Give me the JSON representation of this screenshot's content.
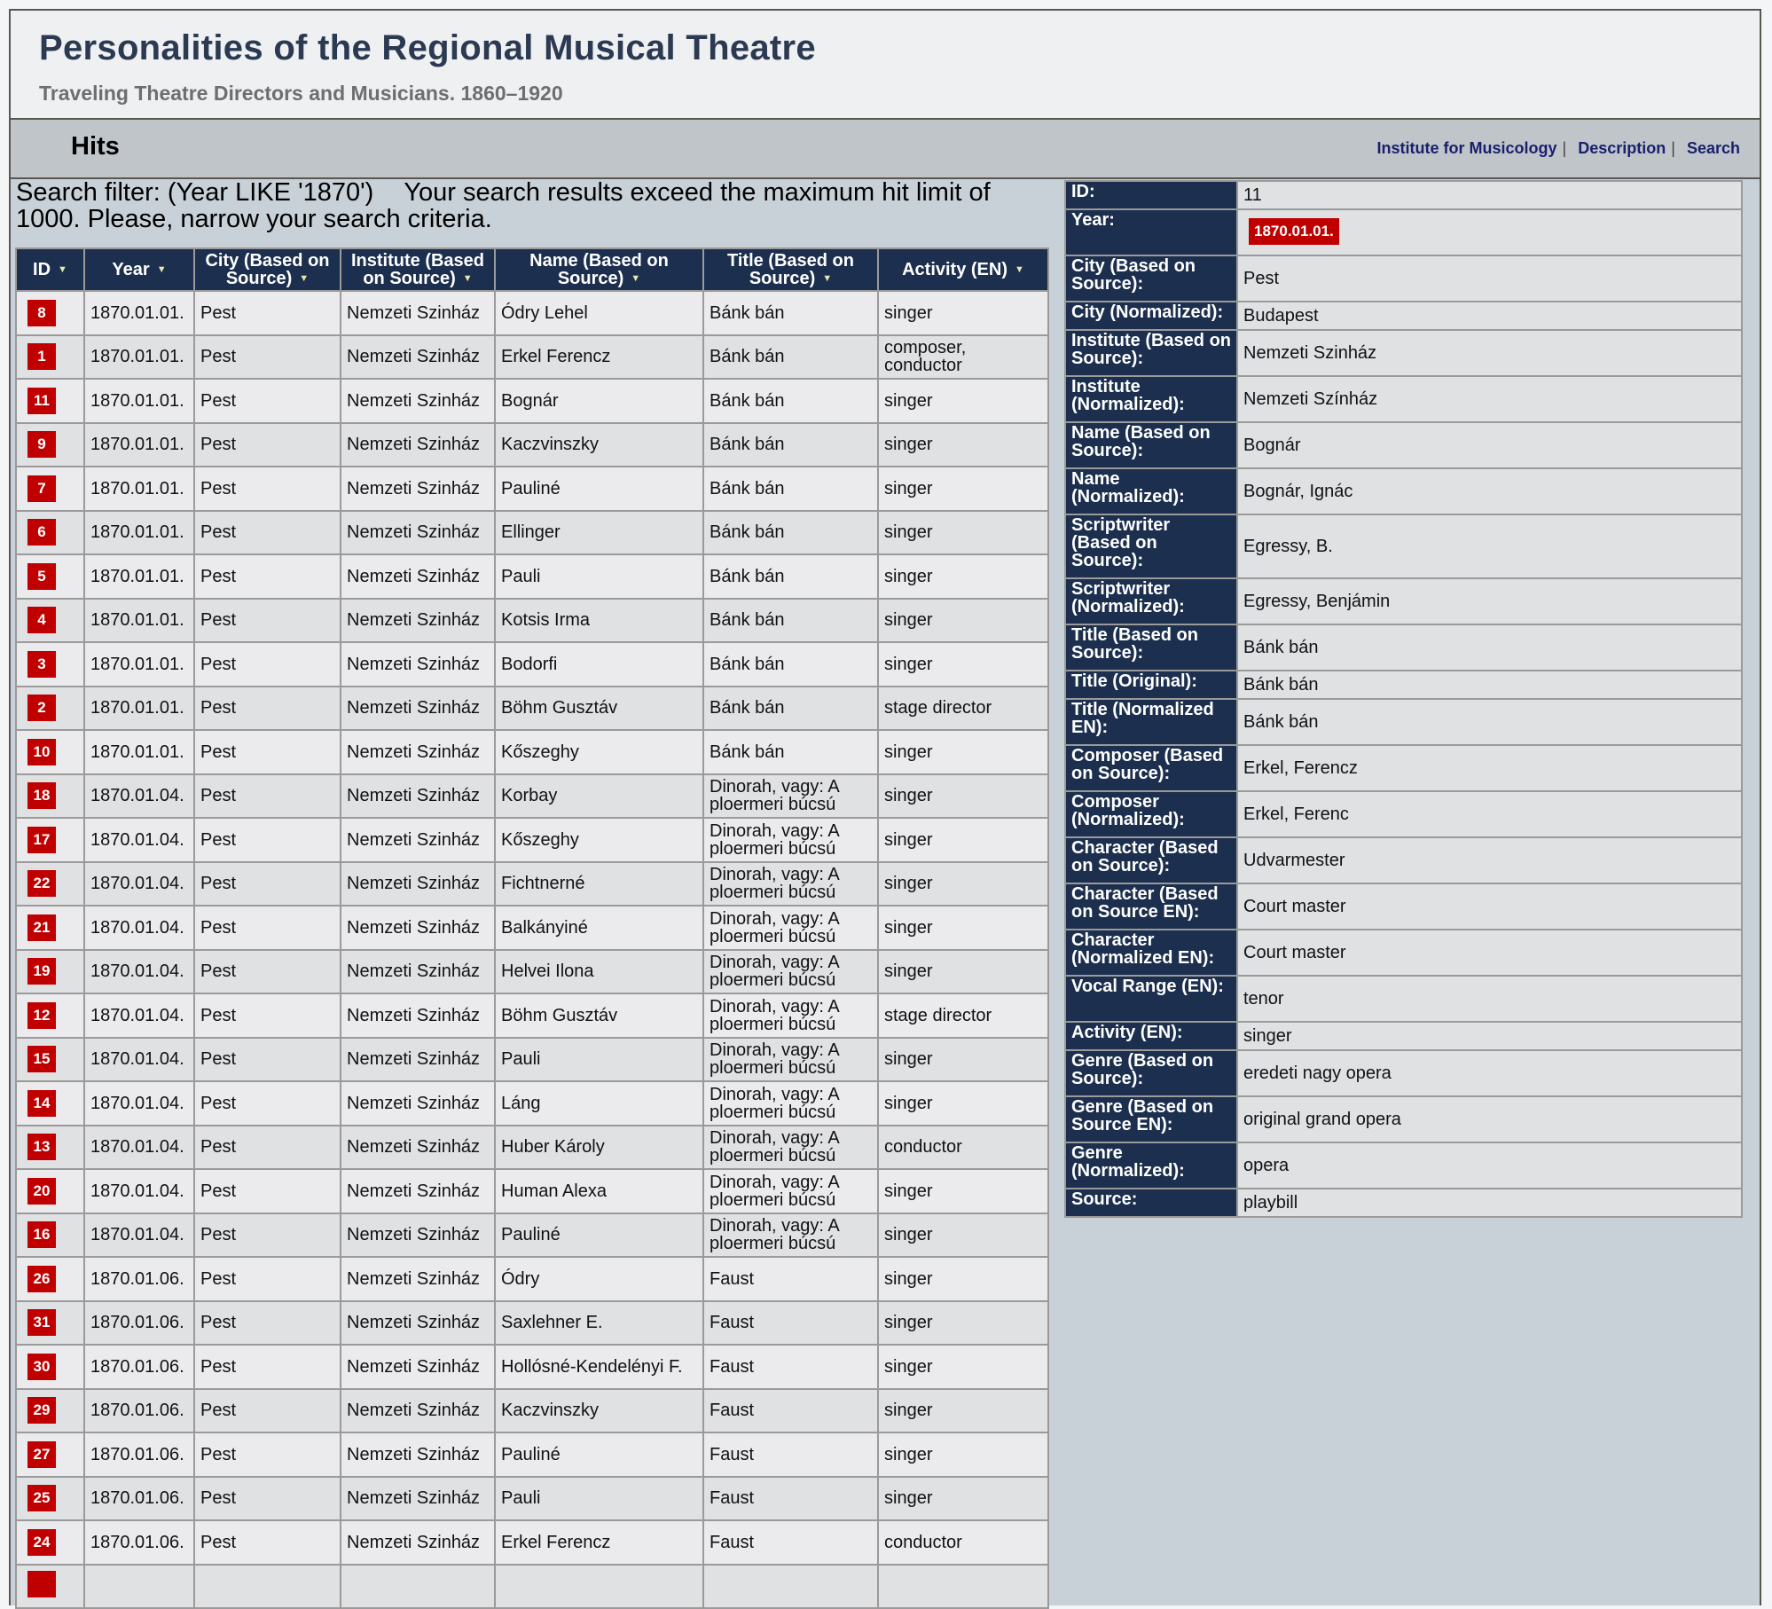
{
  "header": {
    "title": "Personalities of the Regional Musical Theatre",
    "subtitle": "Traveling Theatre Directors and Musicians. 1860–1920"
  },
  "nav": {
    "page_title": "Hits",
    "links": [
      {
        "label": "Institute for Musicology"
      },
      {
        "label": "Description"
      },
      {
        "label": "Search"
      }
    ],
    "separator": "|"
  },
  "search": {
    "filter_text": "Search filter: (Year LIKE '1870')",
    "warning_text": "Your search results exceed the maximum hit limit of 1000. Please, narrow your search criteria."
  },
  "colors": {
    "header_navy": "#1c2f4e",
    "badge_red": "#c00000",
    "link_navy": "#1a1f6e"
  },
  "table": {
    "sort_icon": "▼",
    "columns": [
      {
        "label": "ID"
      },
      {
        "label": "Year"
      },
      {
        "label": "City (Based on Source)"
      },
      {
        "label": "Institute (Based on Source)"
      },
      {
        "label": "Name (Based on Source)"
      },
      {
        "label": "Title (Based on Source)"
      },
      {
        "label": "Activity (EN)"
      }
    ],
    "rows": [
      {
        "id": "8",
        "year": "1870.01.01.",
        "city": "Pest",
        "institute": "Nemzeti Szinház",
        "name": "Ódry Lehel",
        "title": "Bánk bán",
        "activity": "singer"
      },
      {
        "id": "1",
        "year": "1870.01.01.",
        "city": "Pest",
        "institute": "Nemzeti Szinház",
        "name": "Erkel Ferencz",
        "title": "Bánk bán",
        "activity": "composer, conductor"
      },
      {
        "id": "11",
        "year": "1870.01.01.",
        "city": "Pest",
        "institute": "Nemzeti Szinház",
        "name": "Bognár",
        "title": "Bánk bán",
        "activity": "singer"
      },
      {
        "id": "9",
        "year": "1870.01.01.",
        "city": "Pest",
        "institute": "Nemzeti Szinház",
        "name": "Kaczvinszky",
        "title": "Bánk bán",
        "activity": "singer"
      },
      {
        "id": "7",
        "year": "1870.01.01.",
        "city": "Pest",
        "institute": "Nemzeti Szinház",
        "name": "Pauliné",
        "title": "Bánk bán",
        "activity": "singer"
      },
      {
        "id": "6",
        "year": "1870.01.01.",
        "city": "Pest",
        "institute": "Nemzeti Szinház",
        "name": "Ellinger",
        "title": "Bánk bán",
        "activity": "singer"
      },
      {
        "id": "5",
        "year": "1870.01.01.",
        "city": "Pest",
        "institute": "Nemzeti Szinház",
        "name": "Pauli",
        "title": "Bánk bán",
        "activity": "singer"
      },
      {
        "id": "4",
        "year": "1870.01.01.",
        "city": "Pest",
        "institute": "Nemzeti Szinház",
        "name": "Kotsis Irma",
        "title": "Bánk bán",
        "activity": "singer"
      },
      {
        "id": "3",
        "year": "1870.01.01.",
        "city": "Pest",
        "institute": "Nemzeti Szinház",
        "name": "Bodorfi",
        "title": "Bánk bán",
        "activity": "singer"
      },
      {
        "id": "2",
        "year": "1870.01.01.",
        "city": "Pest",
        "institute": "Nemzeti Szinház",
        "name": "Böhm Gusztáv",
        "title": "Bánk bán",
        "activity": "stage director"
      },
      {
        "id": "10",
        "year": "1870.01.01.",
        "city": "Pest",
        "institute": "Nemzeti Szinház",
        "name": "Kőszeghy",
        "title": "Bánk bán",
        "activity": "singer"
      },
      {
        "id": "18",
        "year": "1870.01.04.",
        "city": "Pest",
        "institute": "Nemzeti Szinház",
        "name": "Korbay",
        "title": "Dinorah, vagy: A ploermeri búcsú",
        "activity": "singer"
      },
      {
        "id": "17",
        "year": "1870.01.04.",
        "city": "Pest",
        "institute": "Nemzeti Szinház",
        "name": "Kőszeghy",
        "title": "Dinorah, vagy: A ploermeri búcsú",
        "activity": "singer"
      },
      {
        "id": "22",
        "year": "1870.01.04.",
        "city": "Pest",
        "institute": "Nemzeti Szinház",
        "name": "Fichtnerné",
        "title": "Dinorah, vagy: A ploermeri búcsú",
        "activity": "singer"
      },
      {
        "id": "21",
        "year": "1870.01.04.",
        "city": "Pest",
        "institute": "Nemzeti Szinház",
        "name": "Balkányiné",
        "title": "Dinorah, vagy: A ploermeri búcsú",
        "activity": "singer"
      },
      {
        "id": "19",
        "year": "1870.01.04.",
        "city": "Pest",
        "institute": "Nemzeti Szinház",
        "name": "Helvei Ilona",
        "title": "Dinorah, vagy: A ploermeri búcsú",
        "activity": "singer"
      },
      {
        "id": "12",
        "year": "1870.01.04.",
        "city": "Pest",
        "institute": "Nemzeti Szinház",
        "name": "Böhm Gusztáv",
        "title": "Dinorah, vagy: A ploermeri búcsú",
        "activity": "stage director"
      },
      {
        "id": "15",
        "year": "1870.01.04.",
        "city": "Pest",
        "institute": "Nemzeti Szinház",
        "name": "Pauli",
        "title": "Dinorah, vagy: A ploermeri búcsú",
        "activity": "singer"
      },
      {
        "id": "14",
        "year": "1870.01.04.",
        "city": "Pest",
        "institute": "Nemzeti Szinház",
        "name": "Láng",
        "title": "Dinorah, vagy: A ploermeri búcsú",
        "activity": "singer"
      },
      {
        "id": "13",
        "year": "1870.01.04.",
        "city": "Pest",
        "institute": "Nemzeti Szinház",
        "name": "Huber Károly",
        "title": "Dinorah, vagy: A ploermeri búcsú",
        "activity": "conductor"
      },
      {
        "id": "20",
        "year": "1870.01.04.",
        "city": "Pest",
        "institute": "Nemzeti Szinház",
        "name": "Human Alexa",
        "title": "Dinorah, vagy: A ploermeri búcsú",
        "activity": "singer"
      },
      {
        "id": "16",
        "year": "1870.01.04.",
        "city": "Pest",
        "institute": "Nemzeti Szinház",
        "name": "Pauliné",
        "title": "Dinorah, vagy: A ploermeri búcsú",
        "activity": "singer"
      },
      {
        "id": "26",
        "year": "1870.01.06.",
        "city": "Pest",
        "institute": "Nemzeti Szinház",
        "name": "Ódry",
        "title": "Faust",
        "activity": "singer"
      },
      {
        "id": "31",
        "year": "1870.01.06.",
        "city": "Pest",
        "institute": "Nemzeti Szinház",
        "name": "Saxlehner E.",
        "title": "Faust",
        "activity": "singer"
      },
      {
        "id": "30",
        "year": "1870.01.06.",
        "city": "Pest",
        "institute": "Nemzeti Szinház",
        "name": "Hollósné-Kendelényi F.",
        "title": "Faust",
        "activity": "singer"
      },
      {
        "id": "29",
        "year": "1870.01.06.",
        "city": "Pest",
        "institute": "Nemzeti Szinház",
        "name": "Kaczvinszky",
        "title": "Faust",
        "activity": "singer"
      },
      {
        "id": "27",
        "year": "1870.01.06.",
        "city": "Pest",
        "institute": "Nemzeti Szinház",
        "name": "Pauliné",
        "title": "Faust",
        "activity": "singer"
      },
      {
        "id": "25",
        "year": "1870.01.06.",
        "city": "Pest",
        "institute": "Nemzeti Szinház",
        "name": "Pauli",
        "title": "Faust",
        "activity": "singer"
      },
      {
        "id": "24",
        "year": "1870.01.06.",
        "city": "Pest",
        "institute": "Nemzeti Szinház",
        "name": "Erkel Ferencz",
        "title": "Faust",
        "activity": "conductor"
      },
      {
        "id": "",
        "year": "",
        "city": "",
        "institute": "",
        "name": "",
        "title": "",
        "activity": ""
      }
    ]
  },
  "detail": {
    "fields": [
      {
        "label": "ID:",
        "value": "11",
        "size": 1
      },
      {
        "label": "Year:",
        "value": "1870.01.01.",
        "badge": true,
        "size": 2
      },
      {
        "label": "City (Based on Source):",
        "value": "Pest",
        "size": 2
      },
      {
        "label": "City (Normalized):",
        "value": "Budapest",
        "size": 1
      },
      {
        "label": "Institute (Based on Source):",
        "value": "Nemzeti Szinház",
        "size": 2
      },
      {
        "label": "Institute (Normalized):",
        "value": "Nemzeti Színház",
        "size": 2
      },
      {
        "label": "Name (Based on Source):",
        "value": "Bognár",
        "size": 2
      },
      {
        "label": "Name (Normalized):",
        "value": "Bognár, Ignác",
        "size": 2
      },
      {
        "label": "Scriptwriter (Based on Source):",
        "value": "Egressy, B.",
        "size": 3
      },
      {
        "label": "Scriptwriter (Normalized):",
        "value": "Egressy, Benjámin",
        "size": 2
      },
      {
        "label": "Title (Based on Source):",
        "value": "Bánk bán",
        "size": 2
      },
      {
        "label": "Title (Original):",
        "value": "Bánk bán",
        "size": 1
      },
      {
        "label": "Title (Normalized EN):",
        "value": "Bánk bán",
        "size": 2
      },
      {
        "label": "Composer (Based on Source):",
        "value": "Erkel, Ferencz",
        "size": 2
      },
      {
        "label": "Composer (Normalized):",
        "value": "Erkel, Ferenc",
        "size": 2
      },
      {
        "label": "Character (Based on Source):",
        "value": "Udvarmester",
        "size": 2
      },
      {
        "label": "Character (Based on Source EN):",
        "value": "Court master",
        "size": 2
      },
      {
        "label": "Character (Normalized EN):",
        "value": "Court master",
        "size": 2
      },
      {
        "label": "Vocal Range (EN):",
        "value": "tenor",
        "size": 2
      },
      {
        "label": "Activity (EN):",
        "value": "singer",
        "size": 1
      },
      {
        "label": "Genre (Based on Source):",
        "value": "eredeti nagy opera",
        "size": 2
      },
      {
        "label": "Genre (Based on Source EN):",
        "value": "original grand opera",
        "size": 2
      },
      {
        "label": "Genre (Normalized):",
        "value": "opera",
        "size": 2
      },
      {
        "label": "Source:",
        "value": "playbill",
        "size": 1
      }
    ]
  }
}
